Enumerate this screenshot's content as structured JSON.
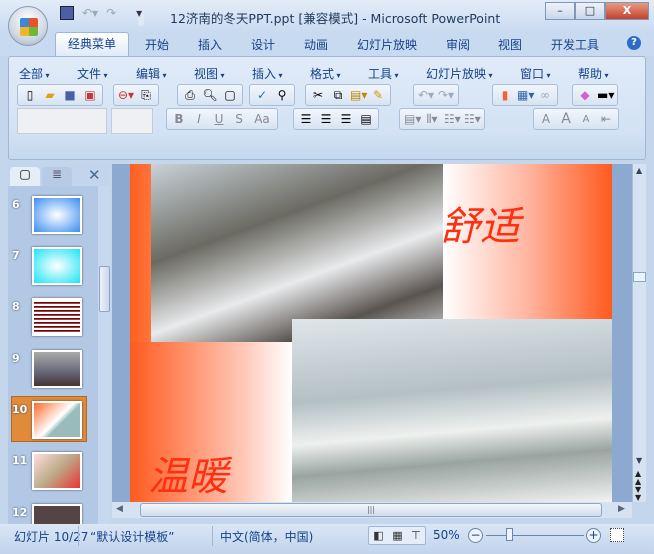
{
  "window": {
    "title": "12济南的冬天PPT.ppt [兼容模式] - Microsoft PowerPoint",
    "minimize": "–",
    "maximize": "□",
    "close": "X"
  },
  "ribbon_tabs": [
    "经典菜单",
    "开始",
    "插入",
    "设计",
    "动画",
    "幻灯片放映",
    "审阅",
    "视图",
    "开发工具"
  ],
  "menus": [
    "全部",
    "文件",
    "编辑",
    "视图",
    "插入",
    "格式",
    "工具",
    "幻灯片放映",
    "窗口",
    "帮助"
  ],
  "format_buttons": [
    "B",
    "I",
    "U",
    "S",
    "Aa"
  ],
  "font_size_buttons": [
    "A",
    "A",
    "A"
  ],
  "slides": [
    {
      "num": "6"
    },
    {
      "num": "7"
    },
    {
      "num": "8"
    },
    {
      "num": "9"
    },
    {
      "num": "10"
    },
    {
      "num": "11"
    },
    {
      "num": "12"
    }
  ],
  "slide_content": {
    "text_top": "舒适",
    "text_bottom": "温暖"
  },
  "status": {
    "slide": "幻灯片 10/27",
    "template": "“默认设计模板”",
    "language": "中文(简体，中国)",
    "zoom": "50%",
    "zoom_value": 50
  },
  "colors": {
    "accent": "#ff5a1e",
    "selected_thumb": "#e08a3a"
  }
}
